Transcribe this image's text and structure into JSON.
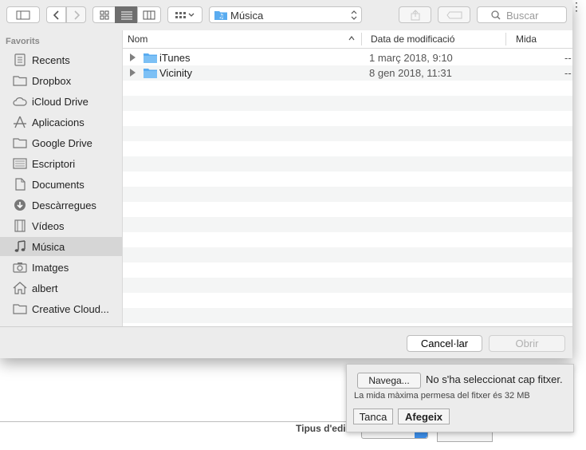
{
  "toolbar": {
    "location": "Música",
    "search_placeholder": "Buscar"
  },
  "sidebar": {
    "header": "Favorits",
    "items": [
      {
        "label": "Recents",
        "icon": "recents-icon"
      },
      {
        "label": "Dropbox",
        "icon": "folder-icon"
      },
      {
        "label": "iCloud Drive",
        "icon": "cloud-icon"
      },
      {
        "label": "Aplicacions",
        "icon": "applications-icon"
      },
      {
        "label": "Google Drive",
        "icon": "folder-icon"
      },
      {
        "label": "Escriptori",
        "icon": "desktop-icon"
      },
      {
        "label": "Documents",
        "icon": "document-icon"
      },
      {
        "label": "Descàrregues",
        "icon": "download-icon"
      },
      {
        "label": "Vídeos",
        "icon": "film-icon"
      },
      {
        "label": "Música",
        "icon": "music-icon",
        "selected": true
      },
      {
        "label": "Imatges",
        "icon": "camera-icon"
      },
      {
        "label": "albert",
        "icon": "home-icon"
      },
      {
        "label": "Creative Cloud...",
        "icon": "folder-icon"
      }
    ]
  },
  "columns": {
    "name": "Nom",
    "date": "Data de modificació",
    "size": "Mida"
  },
  "files": [
    {
      "name": "iTunes",
      "date": "1 març 2018, 9:10",
      "size": "--"
    },
    {
      "name": "Vicinity",
      "date": "8 gen 2018, 11:31",
      "size": "--"
    }
  ],
  "footer": {
    "cancel": "Cancel·lar",
    "open": "Obrir"
  },
  "upload": {
    "browse": "Navega...",
    "no_file": "No s'ha seleccionat cap fitxer.",
    "max_size": "La mida màxima permesa del fitxer és 32 MB",
    "close": "Tanca",
    "add": "Afegeix"
  },
  "background": {
    "type_label": "Tipus d'edició"
  },
  "colors": {
    "folder": "#5aacf0",
    "selected_row": "#d6d6d6"
  }
}
